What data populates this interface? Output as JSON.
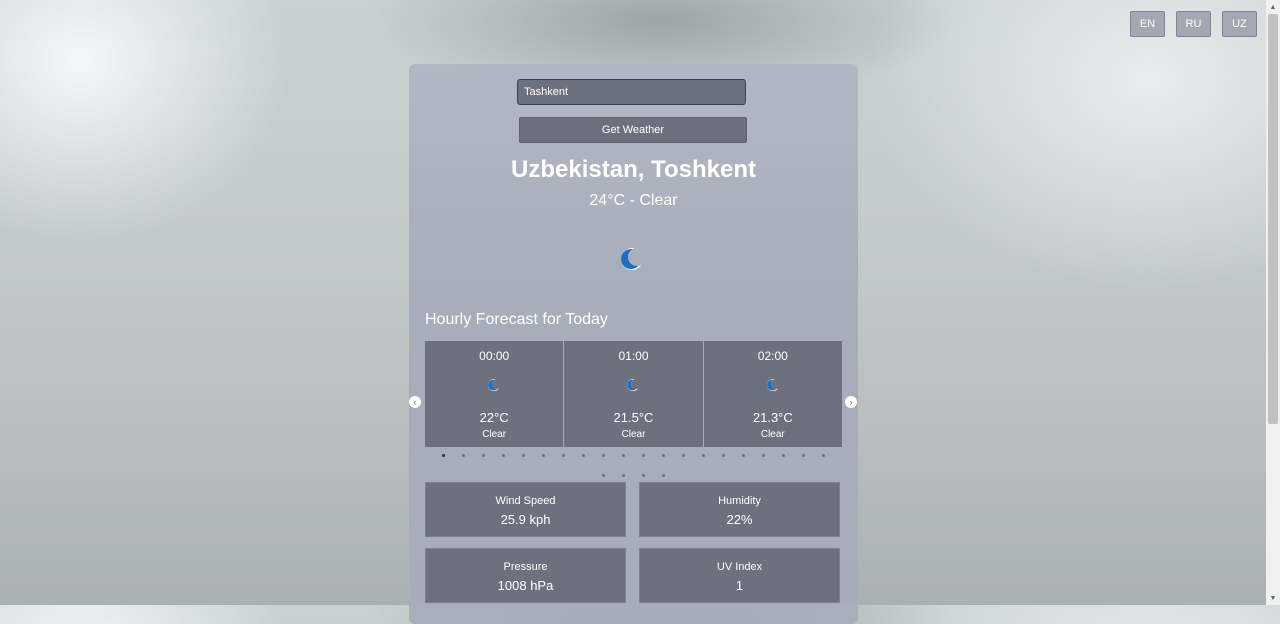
{
  "languages": [
    "EN",
    "RU",
    "UZ"
  ],
  "search": {
    "value": "Tashkent",
    "button_label": "Get Weather"
  },
  "current": {
    "location": "Uzbekistan, Toshkent",
    "summary": "24°C - Clear",
    "icon": "crescent-moon-icon"
  },
  "hourly": {
    "title": "Hourly Forecast for Today",
    "items": [
      {
        "time": "00:00",
        "temp": "22°C",
        "condition": "Clear",
        "icon": "crescent-moon-icon"
      },
      {
        "time": "01:00",
        "temp": "21.5°C",
        "condition": "Clear",
        "icon": "crescent-moon-icon"
      },
      {
        "time": "02:00",
        "temp": "21.3°C",
        "condition": "Clear",
        "icon": "crescent-moon-icon"
      }
    ],
    "page_count": 24,
    "active_page": 1
  },
  "stats": {
    "wind": {
      "label": "Wind Speed",
      "value": "25.9 kph"
    },
    "humidity": {
      "label": "Humidity",
      "value": "22%"
    },
    "pressure": {
      "label": "Pressure",
      "value": "1008 hPa"
    },
    "uv": {
      "label": "UV Index",
      "value": "1"
    }
  },
  "colors": {
    "moon": "#1d6fc0",
    "panel": "#6d717e"
  }
}
